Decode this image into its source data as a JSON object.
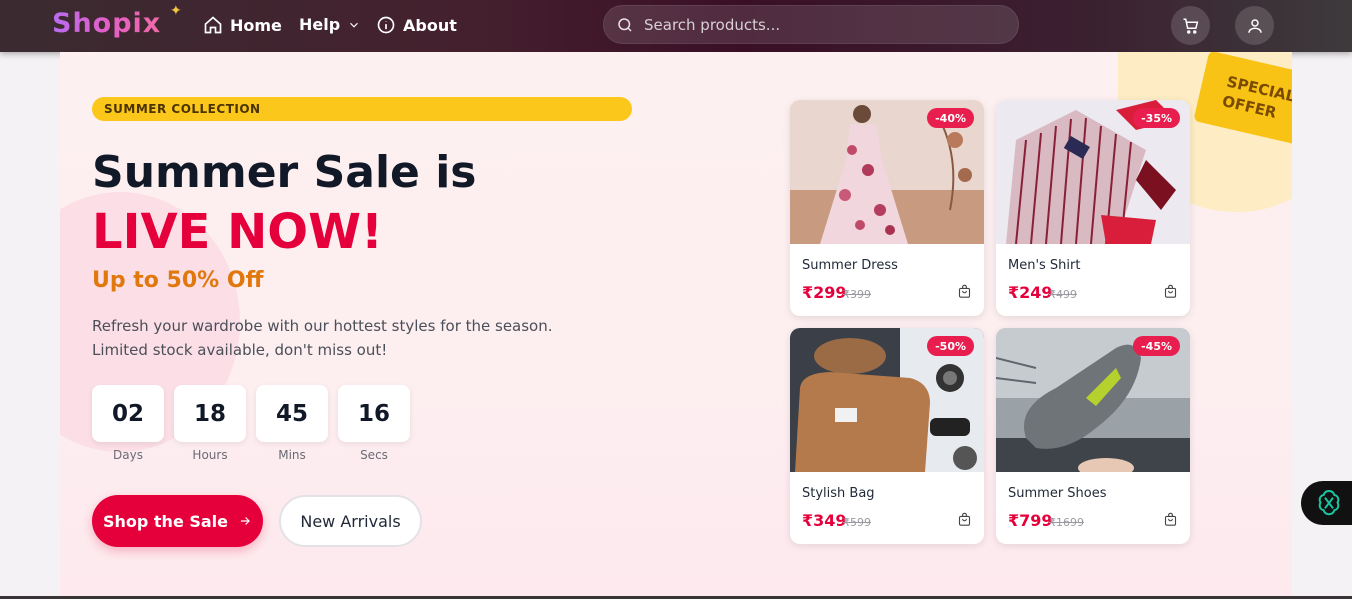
{
  "nav": {
    "logo": "Shopix",
    "links": [
      {
        "label": "Home",
        "icon": "home-icon"
      },
      {
        "label": "Help",
        "icon": "chevron-down-icon"
      },
      {
        "label": "About",
        "icon": "info-icon"
      }
    ],
    "search_placeholder": "Search products...",
    "cart_icon": "cart-icon",
    "user_icon": "user-icon"
  },
  "hero": {
    "badge": "SUMMER COLLECTION",
    "headline": "Summer Sale is",
    "headline_highlight": "LIVE NOW!",
    "subheadline": "Up to 50% Off",
    "description_line1": "Refresh your wardrobe with our hottest styles for the season.",
    "description_line2": "Limited stock available, don't miss out!",
    "countdown": [
      {
        "value": "02",
        "label": "Days"
      },
      {
        "value": "18",
        "label": "Hours"
      },
      {
        "value": "45",
        "label": "Mins"
      },
      {
        "value": "16",
        "label": "Secs"
      }
    ],
    "primary_button": "Shop the Sale",
    "secondary_button": "New Arrivals",
    "special_offer_line1": "SPECIAL",
    "special_offer_line2": "OFFER"
  },
  "products": [
    {
      "name": "Summer Dress",
      "price": "₹299",
      "old_price": "₹399",
      "discount": "-40%"
    },
    {
      "name": "Men's Shirt",
      "price": "₹249",
      "old_price": "₹499",
      "discount": "-35%"
    },
    {
      "name": "Stylish Bag",
      "price": "₹349",
      "old_price": "₹599",
      "discount": "-50%"
    },
    {
      "name": "Summer Shoes",
      "price": "₹799",
      "old_price": "₹1699",
      "discount": "-45%"
    }
  ],
  "colors": {
    "accent": "#e6003b",
    "orange": "#e0780d",
    "badge_yellow": "#fcc71b",
    "navbar": "#3a0f26"
  }
}
